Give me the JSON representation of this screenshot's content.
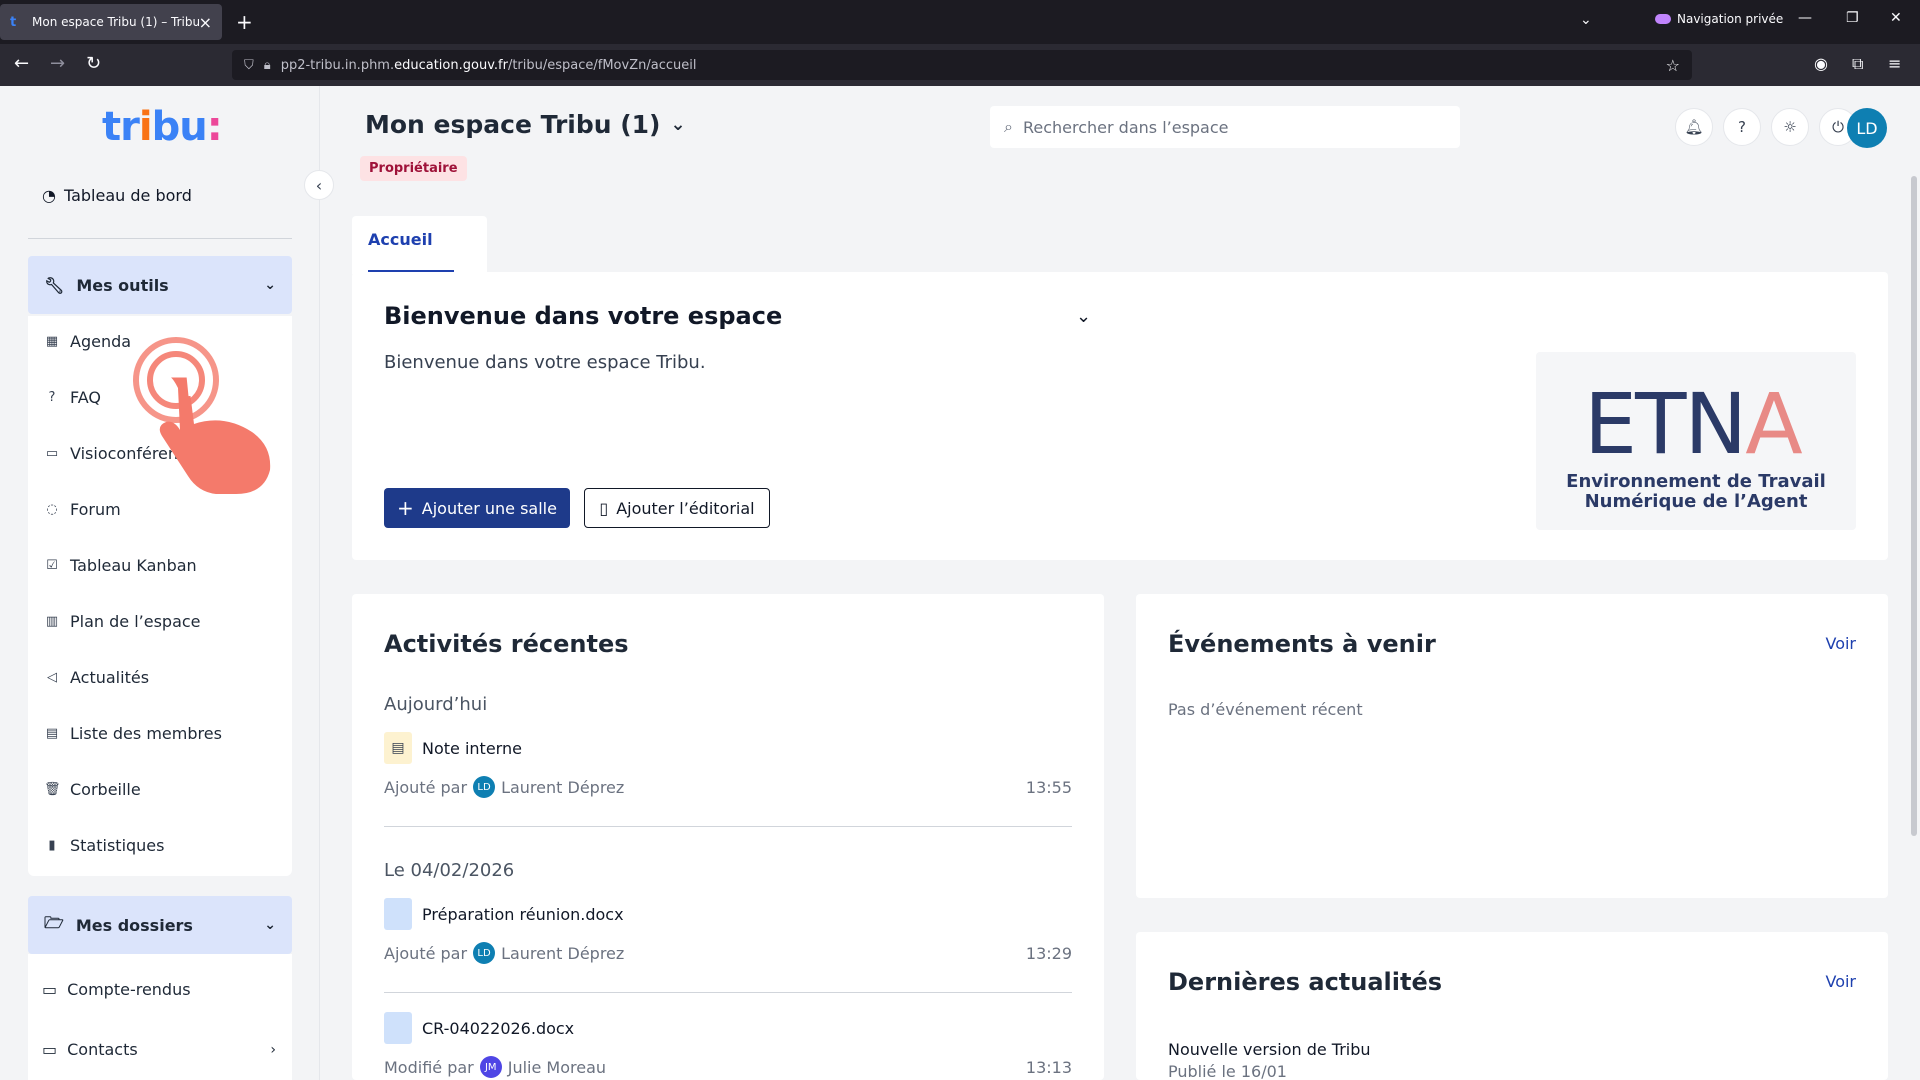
{
  "browser": {
    "tab_title": "Mon espace Tribu (1) – Tribu",
    "new_tab": "+",
    "private_label": "Navigation privée",
    "url_prefix": "pp2-tribu.in.phm.",
    "url_host": "education.gouv.fr",
    "url_path": "/tribu/espace/fMovZn/accueil"
  },
  "sidebar": {
    "logo": [
      "tr",
      "i",
      "bu",
      ":"
    ],
    "dashboard_label": "Tableau de bord",
    "tools_section": "Mes outils",
    "tools": [
      {
        "label": "Agenda",
        "icon": "calendar-icon"
      },
      {
        "label": "FAQ",
        "icon": "question-icon"
      },
      {
        "label": "Visioconférence",
        "icon": "video-icon"
      },
      {
        "label": "Forum",
        "icon": "chat-icon"
      },
      {
        "label": "Tableau Kanban",
        "icon": "checkbox-icon"
      },
      {
        "label": "Plan de l’espace",
        "icon": "map-icon"
      },
      {
        "label": "Actualités",
        "icon": "megaphone-icon"
      },
      {
        "label": "Liste des membres",
        "icon": "contacts-icon"
      },
      {
        "label": "Corbeille",
        "icon": "trash-icon"
      },
      {
        "label": "Statistiques",
        "icon": "stats-icon"
      }
    ],
    "folders_section": "Mes dossiers",
    "folders": [
      {
        "label": "Compte-rendus"
      },
      {
        "label": "Contacts"
      }
    ]
  },
  "header": {
    "space_title": "Mon espace Tribu (1)",
    "role_badge": "Propriétaire",
    "search_placeholder": "Rechercher dans l’espace",
    "avatar_initials": "LD"
  },
  "tabs": [
    {
      "label": "Accueil",
      "active": true
    }
  ],
  "welcome": {
    "title": "Bienvenue dans votre espace",
    "text": "Bienvenue dans votre espace Tribu.",
    "add_room": "Ajouter une salle",
    "add_editorial": "Ajouter l’éditorial",
    "logo_text": "ETNA",
    "logo_sub1": "Environnement de Travail",
    "logo_sub2": "Numérique de l’Agent"
  },
  "activities": {
    "title": "Activités récentes",
    "groups": [
      {
        "day": "Aujourd’hui",
        "items": [
          {
            "name": "Note interne",
            "action": "Ajouté par",
            "user_initials": "LD",
            "user": "Laurent Déprez",
            "time": "13:55"
          }
        ]
      },
      {
        "day": "Le 04/02/2026",
        "items": [
          {
            "name": "Préparation réunion.docx",
            "action": "Ajouté par",
            "user_initials": "LD",
            "user": "Laurent Déprez",
            "time": "13:29"
          },
          {
            "name": "CR-04022026.docx",
            "action": "Modifié par",
            "user_initials": "JM",
            "user": "Julie Moreau",
            "time": "13:13"
          }
        ]
      }
    ]
  },
  "events": {
    "title": "Événements à venir",
    "voir": "Voir",
    "empty": "Pas d’événement récent"
  },
  "news": {
    "title": "Dernières actualités",
    "voir": "Voir",
    "item_title": "Nouvelle version de Tribu",
    "item_date": "Publié le 16/01"
  },
  "colors": {
    "primary": "#1e3a8a",
    "accent_link": "#1e40af",
    "section_bg": "#dbe4fb",
    "badge_bg": "#fde2e4"
  }
}
